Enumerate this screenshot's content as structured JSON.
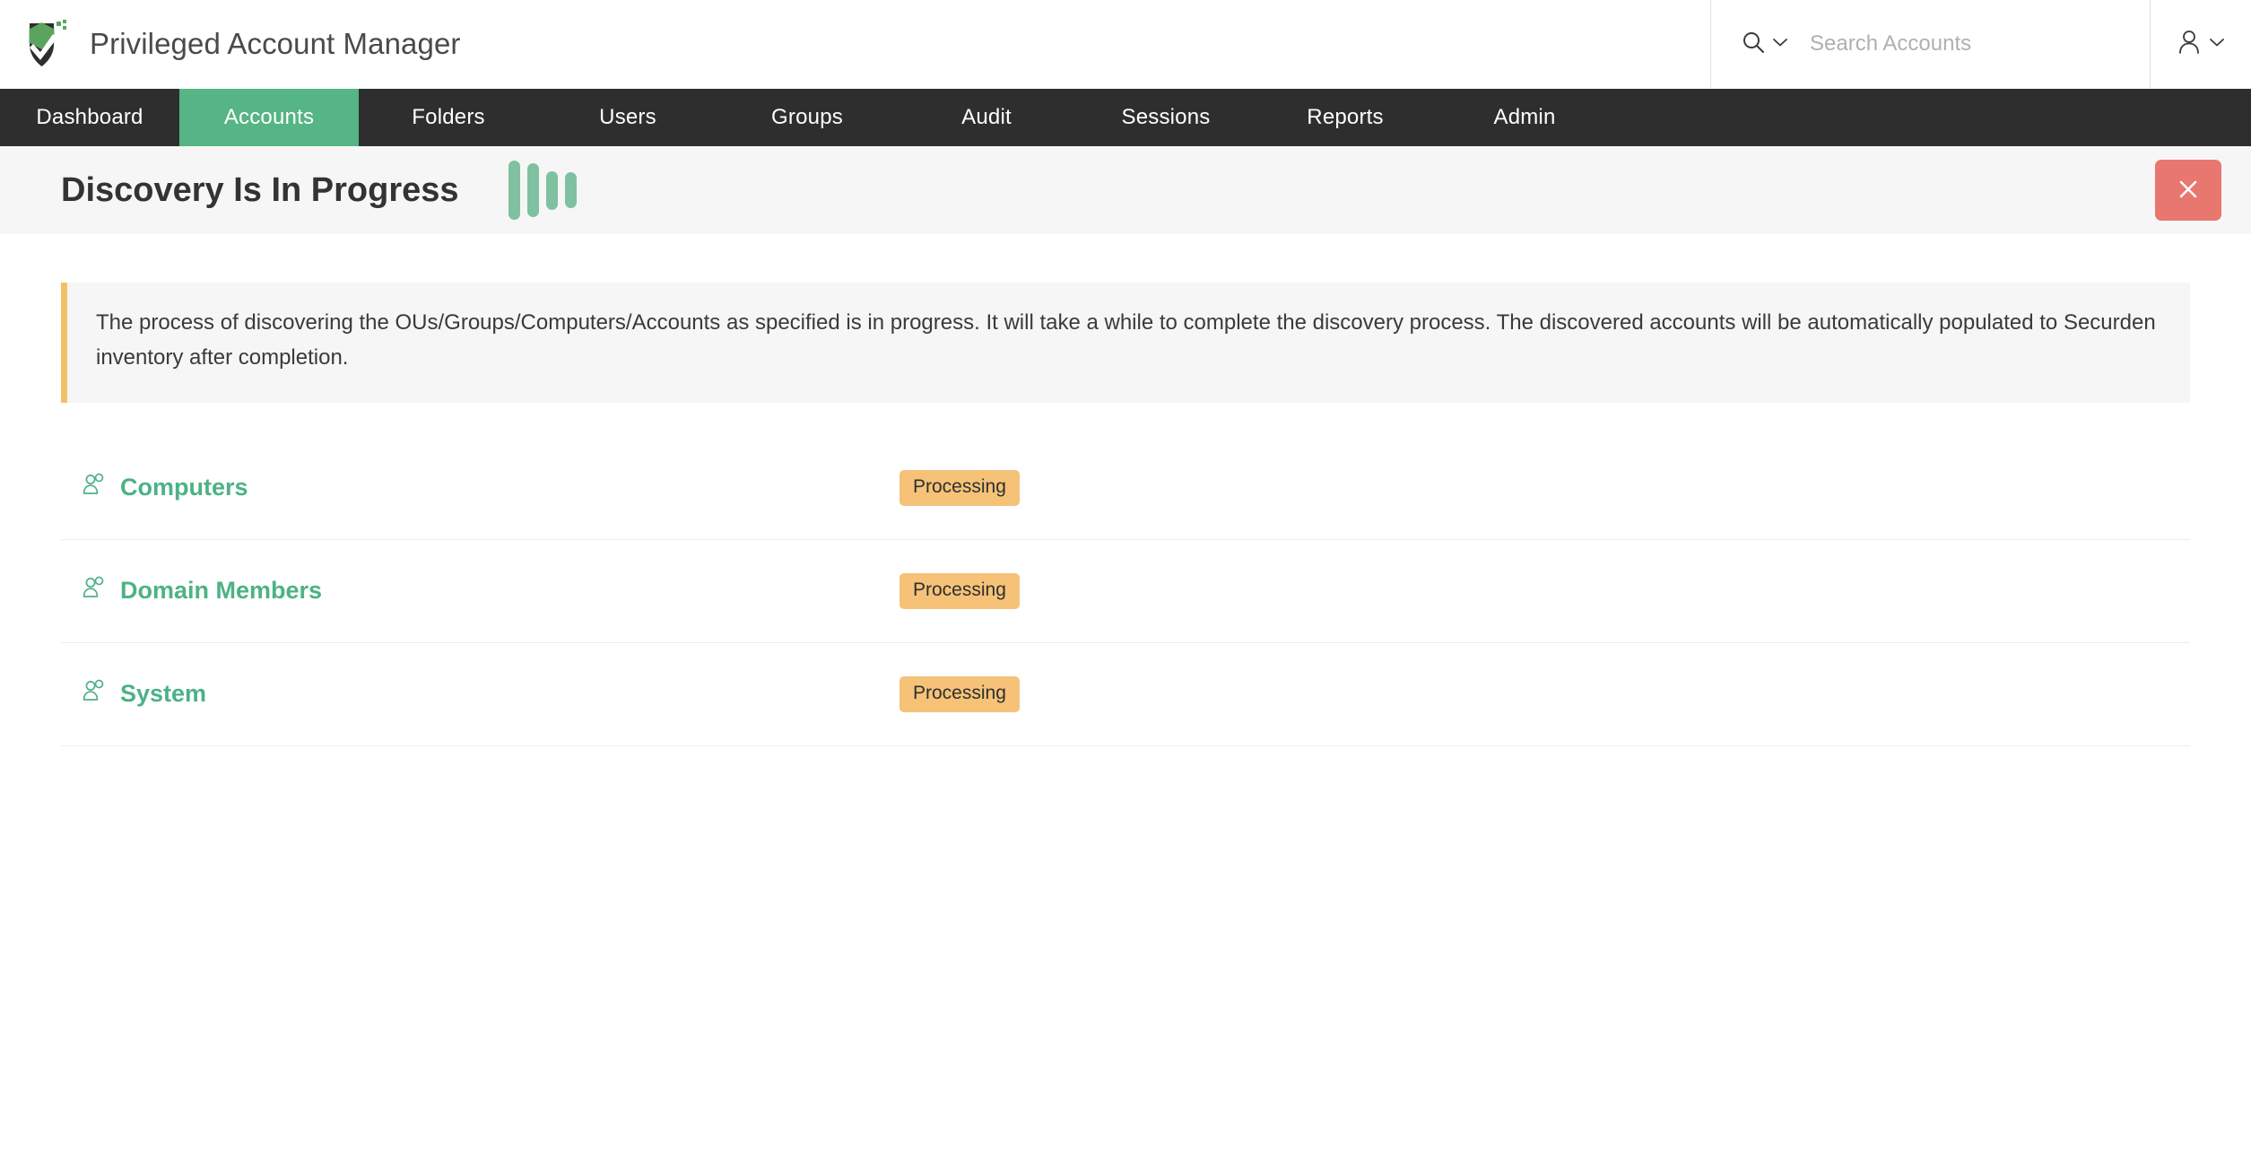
{
  "header": {
    "brand_title": "Privileged Account Manager",
    "logo_icon": "shield-check-logo",
    "search": {
      "icon": "search-icon",
      "dropdown_icon": "chevron-down-icon",
      "placeholder": "Search Accounts",
      "value": ""
    },
    "user_menu": {
      "icon": "user-icon",
      "dropdown_icon": "chevron-down-icon"
    }
  },
  "nav": {
    "items": [
      {
        "label": "Dashboard",
        "active": false
      },
      {
        "label": "Accounts",
        "active": true
      },
      {
        "label": "Folders",
        "active": false
      },
      {
        "label": "Users",
        "active": false
      },
      {
        "label": "Groups",
        "active": false
      },
      {
        "label": "Audit",
        "active": false
      },
      {
        "label": "Sessions",
        "active": false
      },
      {
        "label": "Reports",
        "active": false
      },
      {
        "label": "Admin",
        "active": false
      }
    ],
    "active_color": "#55b584",
    "bar_color": "#2e2e2e"
  },
  "page": {
    "title": "Discovery Is In Progress",
    "loader_icon": "loading-bars-icon",
    "loader_color": "#7fc0a0",
    "close_button": {
      "icon": "close-icon",
      "color": "#e8776f"
    }
  },
  "notice": {
    "text": "The process of discovering the OUs/Groups/Computers/Accounts as specified is in progress. It will take a while to complete the discovery process. The discovered accounts will be automatically populated to Securden inventory after completion.",
    "accent_color": "#f3c165",
    "background_color": "#f6f6f6"
  },
  "discovery_rows": [
    {
      "icon": "group-users-icon",
      "label": "Computers",
      "status": "Processing"
    },
    {
      "icon": "group-users-icon",
      "label": "Domain Members",
      "status": "Processing"
    },
    {
      "icon": "group-users-icon",
      "label": "System",
      "status": "Processing"
    }
  ],
  "colors": {
    "accent_green": "#4cb285",
    "badge_amber": "#f5c278",
    "danger_red": "#e8776f",
    "text_dark": "#333333"
  }
}
